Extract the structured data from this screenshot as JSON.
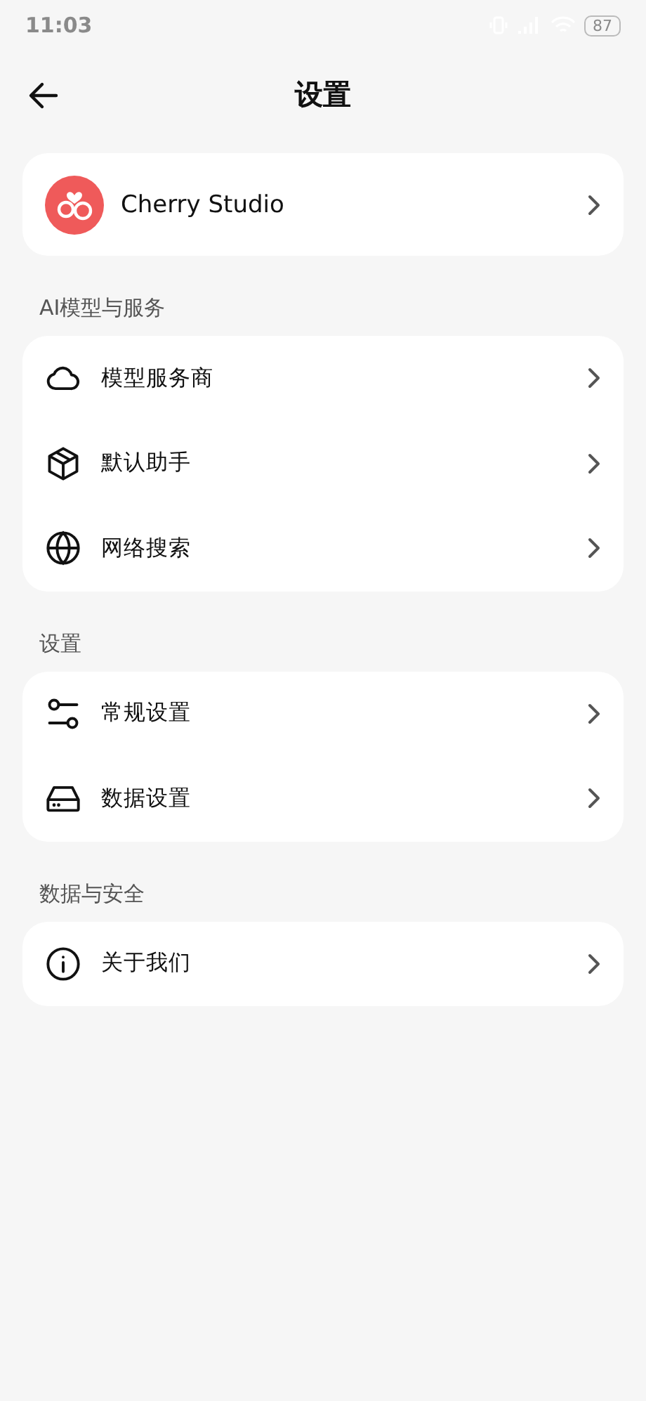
{
  "status_bar": {
    "time": "11:03",
    "battery": "87"
  },
  "header": {
    "title": "设置"
  },
  "app_card": {
    "name": "Cherry Studio"
  },
  "sections": [
    {
      "title": "AI模型与服务",
      "items": [
        {
          "kind": "cloud",
          "label": "模型服务商"
        },
        {
          "kind": "box",
          "label": "默认助手"
        },
        {
          "kind": "globe",
          "label": "网络搜索"
        }
      ]
    },
    {
      "title": "设置",
      "items": [
        {
          "kind": "sliders",
          "label": "常规设置"
        },
        {
          "kind": "drive",
          "label": "数据设置"
        }
      ]
    },
    {
      "title": "数据与安全",
      "items": [
        {
          "kind": "info",
          "label": "关于我们"
        }
      ]
    }
  ]
}
